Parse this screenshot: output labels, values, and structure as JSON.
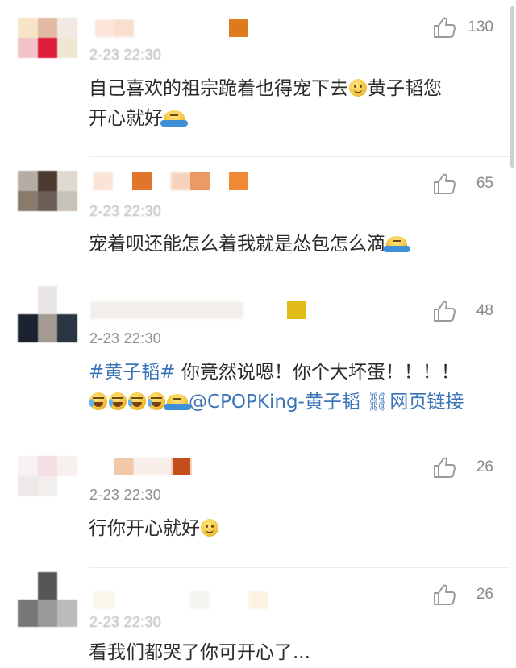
{
  "comments": [
    {
      "time": "2-23 22:30",
      "likes": "130",
      "lines": [
        "自己喜欢的祖宗跪着也得宠下去",
        "黄子韬您",
        "开心就好"
      ]
    },
    {
      "time": "2-23 22:30",
      "likes": "65",
      "text": "宠着呗还能怎么着我就是怂包怎么滴"
    },
    {
      "time": "2-23 22:30",
      "likes": "48",
      "hashtag": "#黄子韬#",
      "line1_rest": " 你竟然说嗯！你个大坏蛋！！！！",
      "mention": "@CPOPKing-黄子韬",
      "web_link": "网页链接"
    },
    {
      "time": "2-23 22:30",
      "likes": "26",
      "text": "行你开心就好"
    },
    {
      "time": "2-23 22:30",
      "likes": "26",
      "text": "看我们都哭了你可开心了..."
    }
  ],
  "colors": {
    "link": "#3b74b8",
    "timestamp": "#8f8f8f",
    "like_icon": "#9a9a9a"
  }
}
